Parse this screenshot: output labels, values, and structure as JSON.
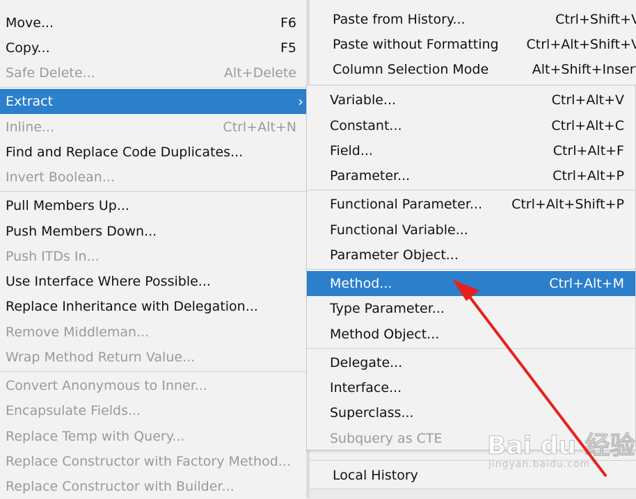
{
  "left_menu": {
    "items": [
      {
        "label": "Move...",
        "shortcut": "F6",
        "enabled": true
      },
      {
        "label": "Copy...",
        "shortcut": "F5",
        "enabled": true
      },
      {
        "label": "Safe Delete...",
        "shortcut": "Alt+Delete",
        "enabled": false
      },
      {
        "label": "Extract",
        "shortcut": "",
        "enabled": true,
        "selected": true
      },
      {
        "label": "Inline...",
        "shortcut": "Ctrl+Alt+N",
        "enabled": false
      },
      {
        "label": "Find and Replace Code Duplicates...",
        "shortcut": "",
        "enabled": true
      },
      {
        "label": "Invert Boolean...",
        "shortcut": "",
        "enabled": false
      },
      {
        "label": "Pull Members Up...",
        "shortcut": "",
        "enabled": true
      },
      {
        "label": "Push Members Down...",
        "shortcut": "",
        "enabled": true
      },
      {
        "label": "Push ITDs In...",
        "shortcut": "",
        "enabled": false
      },
      {
        "label": "Use Interface Where Possible...",
        "shortcut": "",
        "enabled": true
      },
      {
        "label": "Replace Inheritance with Delegation...",
        "shortcut": "",
        "enabled": true
      },
      {
        "label": "Remove Middleman...",
        "shortcut": "",
        "enabled": false
      },
      {
        "label": "Wrap Method Return Value...",
        "shortcut": "",
        "enabled": false
      },
      {
        "label": "Convert Anonymous to Inner...",
        "shortcut": "",
        "enabled": false
      },
      {
        "label": "Encapsulate Fields...",
        "shortcut": "",
        "enabled": false
      },
      {
        "label": "Replace Temp with Query...",
        "shortcut": "",
        "enabled": false
      },
      {
        "label": "Replace Constructor with Factory Method...",
        "shortcut": "",
        "enabled": false
      },
      {
        "label": "Replace Constructor with Builder...",
        "shortcut": "",
        "enabled": false
      }
    ]
  },
  "edit_menu": {
    "items": [
      {
        "label": "Paste from History...",
        "shortcut": "Ctrl+Shift+V"
      },
      {
        "label": "Paste without Formatting",
        "shortcut": "Ctrl+Alt+Shift+V"
      },
      {
        "label": "Column Selection Mode",
        "shortcut": "Alt+Shift+Insert"
      },
      {
        "label": "Local History",
        "shortcut": ""
      }
    ]
  },
  "extract_submenu": {
    "items": [
      {
        "label": "Variable...",
        "shortcut": "Ctrl+Alt+V",
        "enabled": true
      },
      {
        "label": "Constant...",
        "shortcut": "Ctrl+Alt+C",
        "enabled": true
      },
      {
        "label": "Field...",
        "shortcut": "Ctrl+Alt+F",
        "enabled": true
      },
      {
        "label": "Parameter...",
        "shortcut": "Ctrl+Alt+P",
        "enabled": true
      },
      {
        "label": "Functional Parameter...",
        "shortcut": "Ctrl+Alt+Shift+P",
        "enabled": true
      },
      {
        "label": "Functional Variable...",
        "shortcut": "",
        "enabled": true
      },
      {
        "label": "Parameter Object...",
        "shortcut": "",
        "enabled": true
      },
      {
        "label": "Method...",
        "shortcut": "Ctrl+Alt+M",
        "enabled": true,
        "selected": true
      },
      {
        "label": "Type Parameter...",
        "shortcut": "",
        "enabled": true
      },
      {
        "label": "Method Object...",
        "shortcut": "",
        "enabled": true
      },
      {
        "label": "Delegate...",
        "shortcut": "",
        "enabled": true
      },
      {
        "label": "Interface...",
        "shortcut": "",
        "enabled": true
      },
      {
        "label": "Superclass...",
        "shortcut": "",
        "enabled": true
      },
      {
        "label": "Subquery as CTE",
        "shortcut": "",
        "enabled": false
      }
    ]
  },
  "colors": {
    "selection": "#2b7fcb",
    "disabled_text": "#9a9a9a",
    "annotation_arrow": "#e8201c"
  },
  "icons": {
    "submenu_arrow": "chevron-right-icon"
  },
  "watermark": {
    "logo_text": "Bai du 经验",
    "site_text": "jingyan.baidu.com"
  }
}
